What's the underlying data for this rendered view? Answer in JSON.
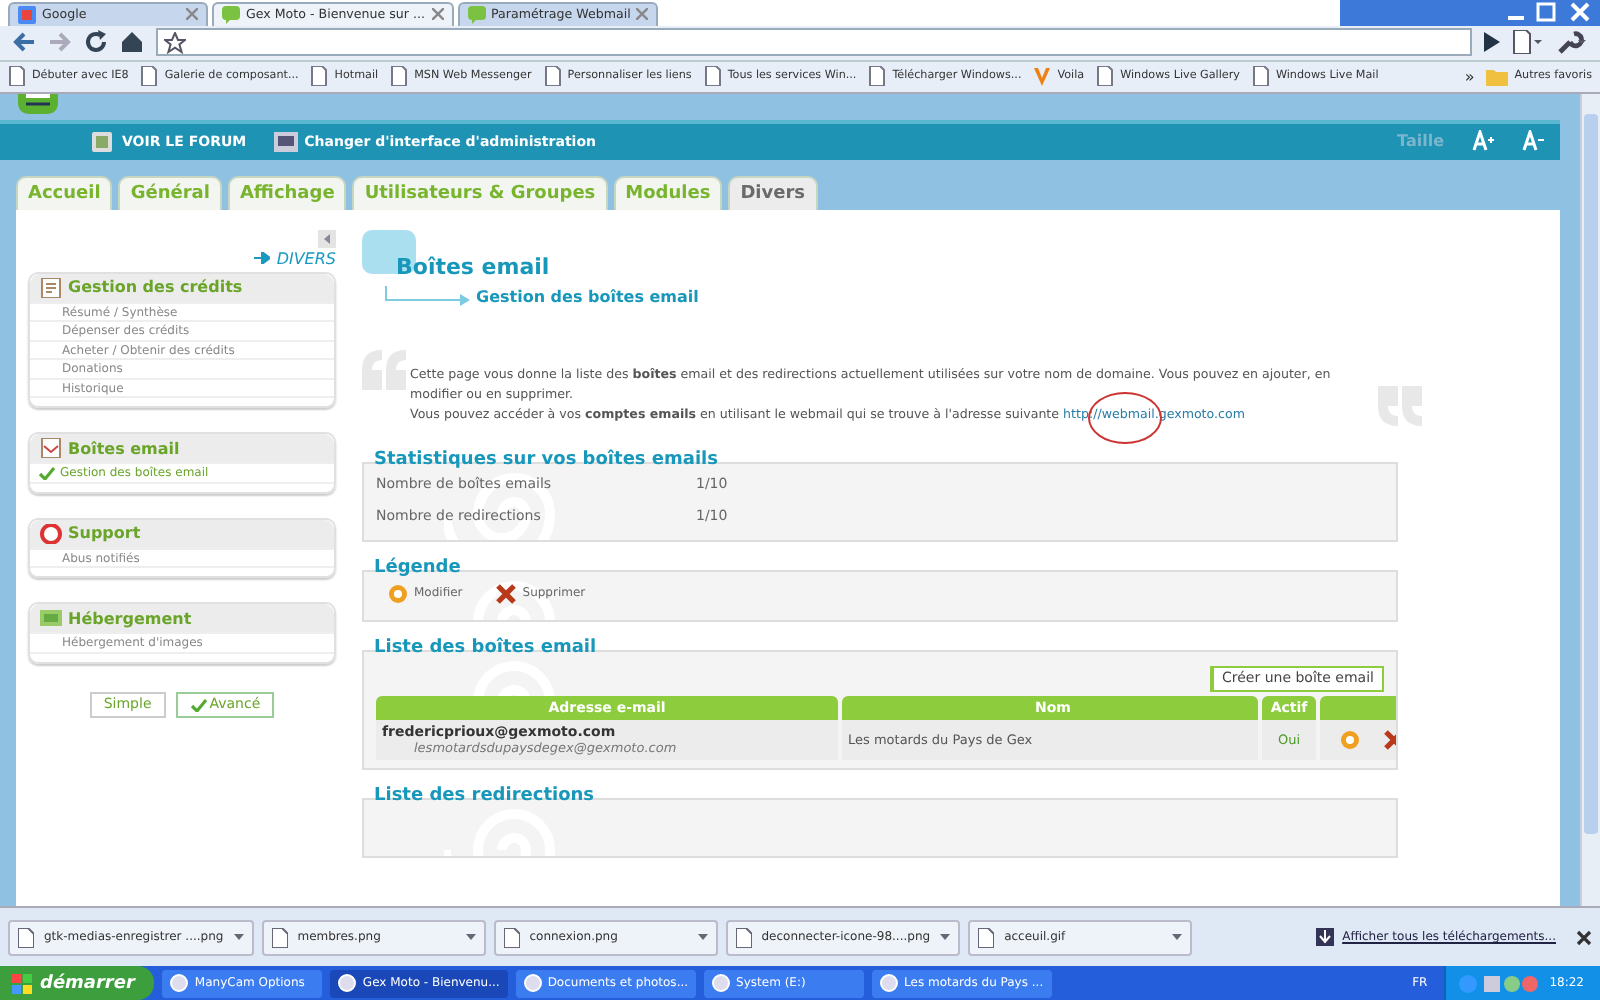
{
  "browser": {
    "tabs": [
      {
        "title": "Google",
        "kind": "google",
        "selected": false
      },
      {
        "title": "Gex Moto - Bienvenue sur ...",
        "kind": "site",
        "selected": true
      },
      {
        "title": "Paramétrage Webmail",
        "kind": "site",
        "selected": false
      }
    ],
    "bookmarks": [
      {
        "label": "Débuter avec IE8",
        "kind": "page"
      },
      {
        "label": "Galerie de composant...",
        "kind": "page"
      },
      {
        "label": "Hotmail",
        "kind": "page"
      },
      {
        "label": "MSN Web Messenger",
        "kind": "page"
      },
      {
        "label": "Personnaliser les liens",
        "kind": "page"
      },
      {
        "label": "Tous les services Win...",
        "kind": "page"
      },
      {
        "label": "Télécharger Windows...",
        "kind": "page"
      },
      {
        "label": "Voila",
        "kind": "voila"
      },
      {
        "label": "Windows Live Gallery",
        "kind": "page"
      },
      {
        "label": "Windows Live Mail",
        "kind": "page"
      }
    ],
    "more": "»",
    "other_bookmarks": "Autres favoris"
  },
  "site_header": {
    "links": [
      "VOIR LE FORUM",
      "Changer d'interface d'administration"
    ],
    "size_label": "Taille"
  },
  "nav_tabs": [
    {
      "label": "Accueil",
      "selected": false
    },
    {
      "label": "Général",
      "selected": false
    },
    {
      "label": "Affichage",
      "selected": false
    },
    {
      "label": "Utilisateurs & Groupes",
      "selected": false
    },
    {
      "label": "Modules",
      "selected": false
    },
    {
      "label": "Divers",
      "selected": true
    }
  ],
  "sidebar": {
    "section_link": "DIVERS",
    "sections": [
      {
        "title": "Gestion des crédits",
        "kind": "credits",
        "items": [
          {
            "label": "Résumé / Synthèse",
            "selected": false
          },
          {
            "label": "Dépenser des crédits",
            "selected": false
          },
          {
            "label": "Acheter / Obtenir des crédits",
            "selected": false
          },
          {
            "label": "Donations",
            "selected": false
          },
          {
            "label": "Historique",
            "selected": false
          }
        ]
      },
      {
        "title": "Boîtes email",
        "kind": "mail",
        "items": [
          {
            "label": "Gestion des boîtes email",
            "selected": true
          }
        ]
      },
      {
        "title": "Support",
        "kind": "support",
        "items": [
          {
            "label": "Abus notifiés",
            "selected": false
          }
        ]
      },
      {
        "title": "Hébergement",
        "kind": "hosting",
        "items": [
          {
            "label": "Hébergement d'images",
            "selected": false
          }
        ]
      }
    ],
    "view_buttons": [
      {
        "label": "Simple",
        "selected": false
      },
      {
        "label": "Avancé",
        "selected": true
      }
    ]
  },
  "main": {
    "title": "Boîtes email",
    "subtitle": "Gestion des boîtes email",
    "intro": "Cette page vous donne la liste des **boîtes** email et des redirections actuellement utilisées sur votre nom de domaine. Vous pouvez en ajouter, en modifier ou en supprimer.",
    "access": "Vous pouvez accéder à vos **comptes emails** en utilisant le webmail qui se trouve à l'adresse suivante ",
    "webmail_link": "http://webmail.gexmoto.com",
    "stats": {
      "title": "Statistiques sur vos boîtes emails",
      "rows": [
        {
          "label": "Nombre de boîtes emails",
          "value": "1/10"
        },
        {
          "label": "Nombre de redirections",
          "value": "1/10"
        }
      ]
    },
    "legend": {
      "title": "Légende",
      "items": [
        {
          "kind": "edit",
          "label": "Modifier"
        },
        {
          "kind": "delete",
          "label": "Supprimer"
        }
      ]
    },
    "mailboxes": {
      "title": "Liste des boîtes email",
      "create_button": "Créer une boîte email",
      "columns": [
        "Adresse e-mail",
        "Nom",
        "Actif"
      ],
      "rows": [
        {
          "address": "fredericprioux@gexmoto.com",
          "alias": "lesmotardsdupaysdegex@gexmoto.com",
          "name": "Les motards du Pays de Gex",
          "active": "Oui"
        }
      ]
    },
    "redirections": {
      "title": "Liste des redirections"
    }
  },
  "downloads": {
    "items": [
      "gtk-medias-enregistrer ....png",
      "membres.png",
      "connexion.png",
      "deconnecter-icone-98....png",
      "acceuil.gif"
    ],
    "show_all": "Afficher tous les téléchargements..."
  },
  "taskbar": {
    "start": "démarrer",
    "tasks": [
      {
        "label": "ManyCam Options",
        "selected": false
      },
      {
        "label": "Gex Moto - Bienvenu...",
        "selected": true
      },
      {
        "label": "Documents et photos...",
        "selected": false
      },
      {
        "label": "System (E:)",
        "selected": false
      },
      {
        "label": "Les motards du Pays ...",
        "selected": false
      }
    ],
    "language": "FR",
    "clock": "18:22"
  }
}
